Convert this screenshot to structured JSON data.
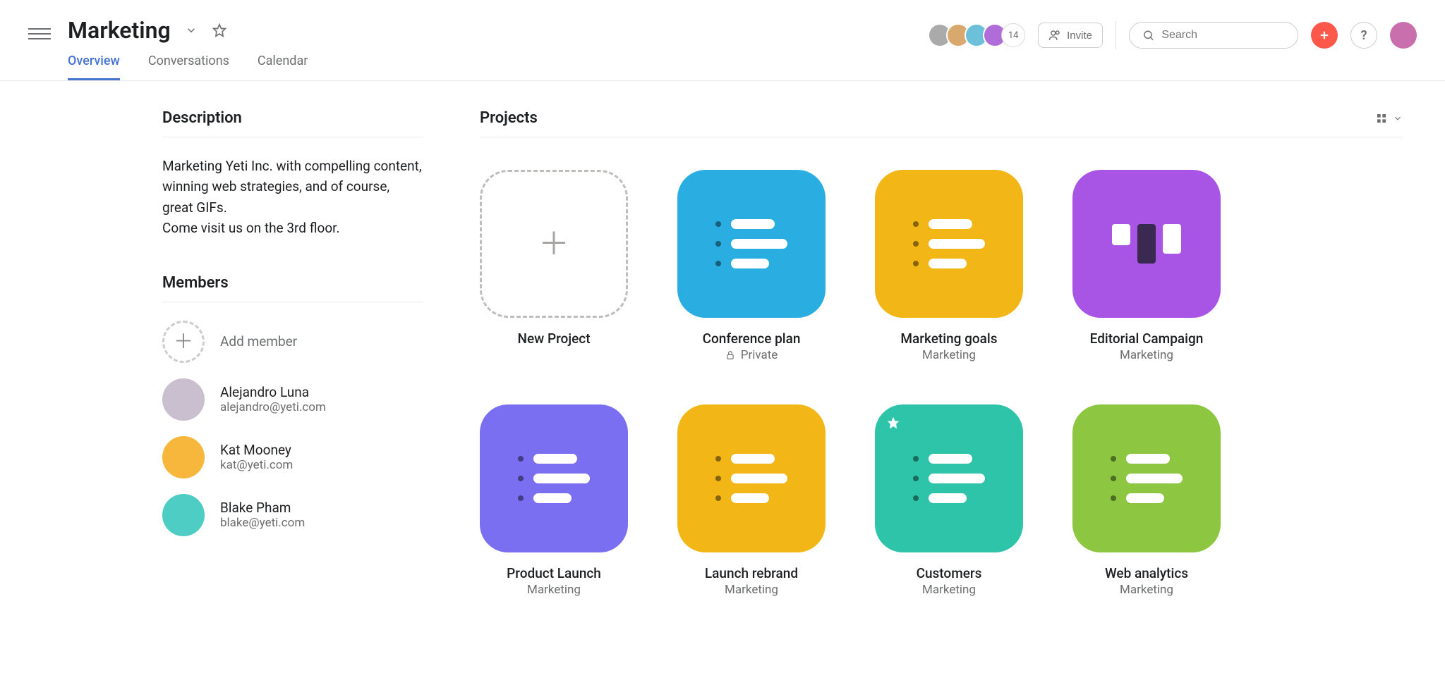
{
  "header": {
    "title": "Marketing",
    "tabs": [
      "Overview",
      "Conversations",
      "Calendar"
    ],
    "active_tab": 0,
    "avatar_colors": [
      "#8a6de9",
      "#d9a86c",
      "#6cc0d9",
      "#b06cd9"
    ],
    "extra_count": "14",
    "invite_label": "Invite",
    "search_placeholder": "Search"
  },
  "description": {
    "heading": "Description",
    "text": "Marketing Yeti Inc. with compelling content, winning web strategies, and of course, great GIFs.\nCome visit us on the 3rd floor."
  },
  "members": {
    "heading": "Members",
    "add_label": "Add member",
    "list": [
      {
        "name": "Alejandro Luna",
        "email": "alejandro@yeti.com",
        "color": "#c9bfcf"
      },
      {
        "name": "Kat Mooney",
        "email": "kat@yeti.com",
        "color": "#f6b73c"
      },
      {
        "name": "Blake Pham",
        "email": "blake@yeti.com",
        "color": "#4ecdc4"
      }
    ]
  },
  "projects": {
    "heading": "Projects",
    "new_label": "New Project",
    "items": [
      {
        "name": "Conference plan",
        "sub": "Private",
        "private": true,
        "color": "#2aaee2",
        "kind": "list"
      },
      {
        "name": "Marketing goals",
        "sub": "Marketing",
        "private": false,
        "color": "#f2b616",
        "kind": "list"
      },
      {
        "name": "Editorial Campaign",
        "sub": "Marketing",
        "private": false,
        "color": "#a855e6",
        "kind": "board"
      },
      {
        "name": "Product Launch",
        "sub": "Marketing",
        "private": false,
        "color": "#7a6ff0",
        "kind": "list"
      },
      {
        "name": "Launch rebrand",
        "sub": "Marketing",
        "private": false,
        "color": "#f2b616",
        "kind": "list"
      },
      {
        "name": "Customers",
        "sub": "Marketing",
        "private": false,
        "color": "#2dc4aa",
        "kind": "list",
        "starred": true
      },
      {
        "name": "Web analytics",
        "sub": "Marketing",
        "private": false,
        "color": "#8dc640",
        "kind": "list"
      }
    ]
  }
}
